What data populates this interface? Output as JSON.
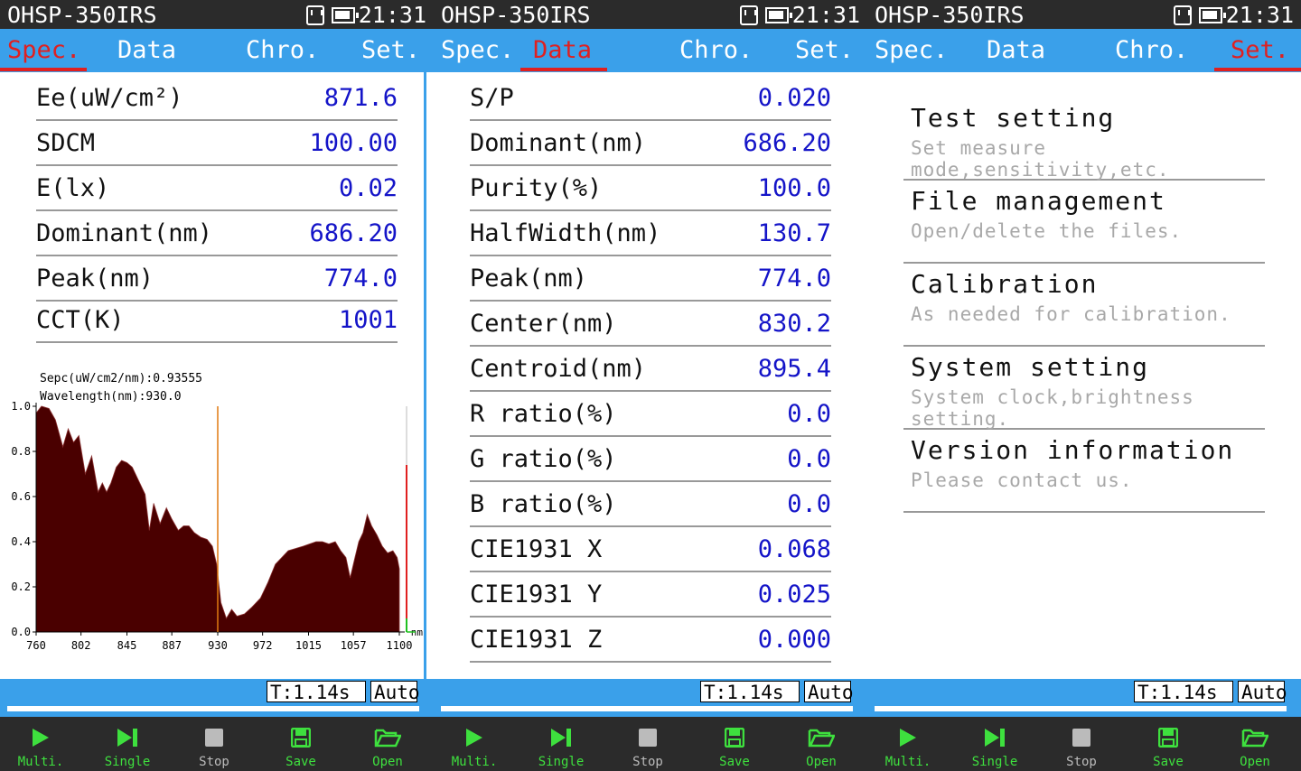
{
  "device_name": "OHSP-350IRS",
  "clock": "21:31",
  "tabs": [
    "Spec.",
    "Data",
    "Chro.",
    "Set."
  ],
  "spec": {
    "rows": [
      {
        "label": "Ee(uW/cm²)",
        "value": "871.6"
      },
      {
        "label": "SDCM",
        "value": "100.00"
      },
      {
        "label": "E(lx)",
        "value": "0.02"
      },
      {
        "label": "Dominant(nm)",
        "value": "686.20"
      },
      {
        "label": "Peak(nm)",
        "value": "774.0"
      },
      {
        "label": "CCT(K)",
        "value": "1001"
      }
    ]
  },
  "chart_data": {
    "type": "area",
    "annotation_spec": "Sepc(uW/cm2/nm):0.93555",
    "annotation_wavelength": "Wavelength(nm):930.0",
    "x_unit": "nm",
    "xlim": [
      760,
      1100
    ],
    "ylim": [
      0,
      1.0
    ],
    "x_ticks": [
      "760",
      "802",
      "845",
      "887",
      "930",
      "972",
      "1015",
      "1057",
      "1100"
    ],
    "y_ticks": [
      "0.0",
      "0.2",
      "0.4",
      "0.6",
      "0.8",
      "1.0"
    ],
    "cursor_wavelength": 930,
    "fill_color": "#4a0000",
    "points": [
      [
        760,
        0.97
      ],
      [
        765,
        1.0
      ],
      [
        772,
        0.99
      ],
      [
        778,
        0.94
      ],
      [
        785,
        0.82
      ],
      [
        790,
        0.9
      ],
      [
        795,
        0.84
      ],
      [
        800,
        0.87
      ],
      [
        806,
        0.7
      ],
      [
        812,
        0.78
      ],
      [
        818,
        0.62
      ],
      [
        822,
        0.66
      ],
      [
        826,
        0.62
      ],
      [
        830,
        0.66
      ],
      [
        835,
        0.73
      ],
      [
        840,
        0.76
      ],
      [
        845,
        0.75
      ],
      [
        850,
        0.73
      ],
      [
        856,
        0.67
      ],
      [
        862,
        0.61
      ],
      [
        866,
        0.45
      ],
      [
        870,
        0.57
      ],
      [
        876,
        0.48
      ],
      [
        882,
        0.55
      ],
      [
        887,
        0.5
      ],
      [
        893,
        0.45
      ],
      [
        898,
        0.47
      ],
      [
        903,
        0.47
      ],
      [
        908,
        0.44
      ],
      [
        914,
        0.42
      ],
      [
        920,
        0.41
      ],
      [
        925,
        0.38
      ],
      [
        929,
        0.3
      ],
      [
        933,
        0.13
      ],
      [
        938,
        0.06
      ],
      [
        943,
        0.1
      ],
      [
        948,
        0.07
      ],
      [
        955,
        0.08
      ],
      [
        962,
        0.11
      ],
      [
        970,
        0.15
      ],
      [
        977,
        0.22
      ],
      [
        984,
        0.3
      ],
      [
        990,
        0.33
      ],
      [
        996,
        0.36
      ],
      [
        1003,
        0.37
      ],
      [
        1010,
        0.38
      ],
      [
        1016,
        0.39
      ],
      [
        1022,
        0.4
      ],
      [
        1028,
        0.4
      ],
      [
        1034,
        0.39
      ],
      [
        1040,
        0.4
      ],
      [
        1045,
        0.36
      ],
      [
        1050,
        0.33
      ],
      [
        1054,
        0.24
      ],
      [
        1058,
        0.32
      ],
      [
        1062,
        0.4
      ],
      [
        1066,
        0.44
      ],
      [
        1070,
        0.52
      ],
      [
        1074,
        0.47
      ],
      [
        1079,
        0.43
      ],
      [
        1084,
        0.38
      ],
      [
        1089,
        0.35
      ],
      [
        1094,
        0.36
      ],
      [
        1098,
        0.33
      ],
      [
        1100,
        0.28
      ]
    ]
  },
  "data": {
    "rows": [
      {
        "label": "S/P",
        "value": "0.020"
      },
      {
        "label": "Dominant(nm)",
        "value": "686.20"
      },
      {
        "label": "Purity(%)",
        "value": "100.0"
      },
      {
        "label": "HalfWidth(nm)",
        "value": "130.7"
      },
      {
        "label": "Peak(nm)",
        "value": "774.0"
      },
      {
        "label": "Center(nm)",
        "value": "830.2"
      },
      {
        "label": "Centroid(nm)",
        "value": "895.4"
      },
      {
        "label": "R ratio(%)",
        "value": "0.0"
      },
      {
        "label": "G ratio(%)",
        "value": "0.0"
      },
      {
        "label": "B ratio(%)",
        "value": "0.0"
      },
      {
        "label": "CIE1931 X",
        "value": "0.068"
      },
      {
        "label": "CIE1931 Y",
        "value": "0.025"
      },
      {
        "label": "CIE1931 Z",
        "value": "0.000"
      }
    ]
  },
  "settings": {
    "items": [
      {
        "title": "Test setting",
        "subtitle": "Set measure mode,sensitivity,etc."
      },
      {
        "title": "File management",
        "subtitle": "Open/delete the files."
      },
      {
        "title": "Calibration",
        "subtitle": "As needed for calibration."
      },
      {
        "title": "System setting",
        "subtitle": "System clock,brightness setting."
      },
      {
        "title": "Version information",
        "subtitle": "Please contact us."
      }
    ]
  },
  "status": {
    "time_text": "T:1.14s",
    "mode_text": "Auto"
  },
  "toolbar": [
    {
      "label": "Multi.",
      "icon": "play-icon",
      "color": "#3ee03e"
    },
    {
      "label": "Single",
      "icon": "step-icon",
      "color": "#3ee03e"
    },
    {
      "label": "Stop",
      "icon": "stop-icon",
      "color": "#bbbbbb"
    },
    {
      "label": "Save",
      "icon": "save-icon",
      "color": "#3ee03e"
    },
    {
      "label": "Open",
      "icon": "folder-open-icon",
      "color": "#3ee03e"
    }
  ]
}
